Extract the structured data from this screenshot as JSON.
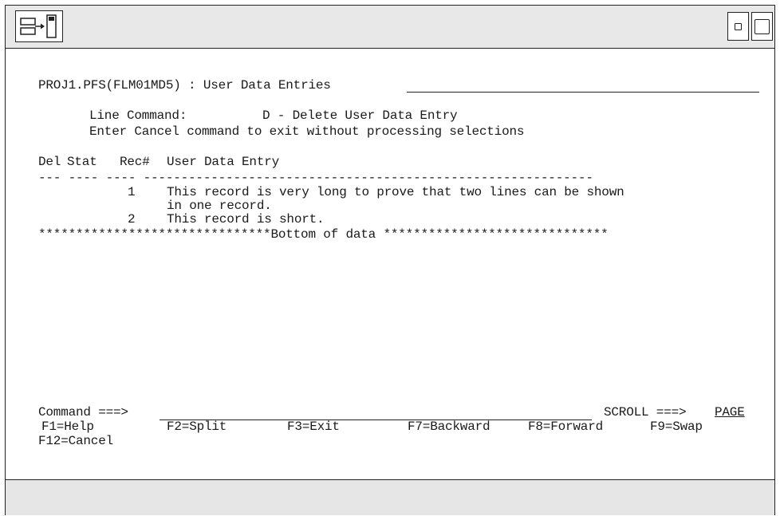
{
  "header": {
    "dataset": "PROJ1.PFS(FLM01MD5)",
    "separator": ":",
    "panel_title": "User Data Entries"
  },
  "instructions": {
    "line_command_label": "Line Command:",
    "line_command_desc": "D - Delete User Data Entry",
    "cancel_hint": "Enter Cancel command to exit without processing selections"
  },
  "table": {
    "columns": [
      "Del",
      "Stat",
      "Rec#",
      "User Data Entry"
    ],
    "rule": "--- ---- ---- ------------------------------------------------------------",
    "rows": [
      {
        "del": "",
        "stat": "",
        "rec": "1",
        "entry": "This record is very long to prove that two lines can be shown",
        "entry_cont": "in one record."
      },
      {
        "del": "",
        "stat": "",
        "rec": "2",
        "entry": "This record is short.",
        "entry_cont": ""
      }
    ],
    "bottom_marker": "*******************************Bottom of data ******************************"
  },
  "command": {
    "label": "Command ===>",
    "value": "",
    "scroll_label": "SCROLL ===>",
    "scroll_value": "PAGE"
  },
  "fkeys": [
    "F1=Help",
    "F2=Split",
    "F3=Exit",
    "F7=Backward",
    "F8=Forward",
    "F9=Swap",
    "F12=Cancel"
  ],
  "icons": {
    "system_menu": "split-window-icon",
    "minimize": "minimize-icon",
    "maximize": "maximize-icon"
  }
}
